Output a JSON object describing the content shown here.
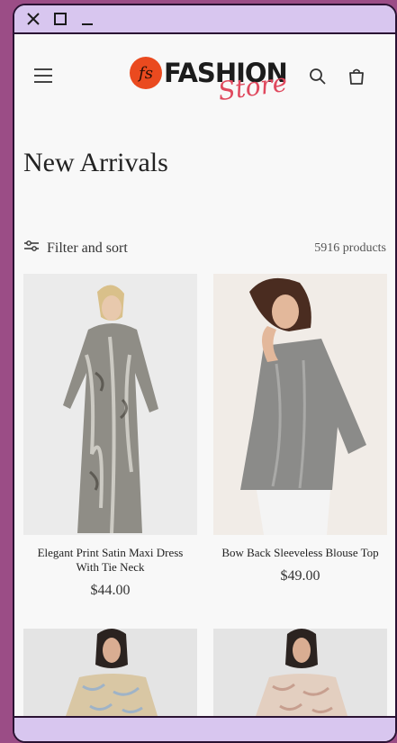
{
  "window": {
    "controls": [
      "close",
      "maximize",
      "minimize"
    ]
  },
  "header": {
    "logo": {
      "mark": "fs",
      "word1": "FASHION",
      "word2": "Store",
      "brand_color": "#ea4a1f",
      "script_color": "#e0495e"
    },
    "icons": [
      "menu-icon",
      "search-icon",
      "cart-icon"
    ]
  },
  "page": {
    "title": "New Arrivals",
    "filter_label": "Filter and sort",
    "product_count": "5916 products"
  },
  "products": [
    {
      "name": "Elegant Print Satin Maxi Dress With Tie Neck",
      "price": "$44.00"
    },
    {
      "name": "Bow Back Sleeveless Blouse Top",
      "price": "$49.00"
    },
    {
      "name": "",
      "price": ""
    },
    {
      "name": "",
      "price": ""
    }
  ]
}
